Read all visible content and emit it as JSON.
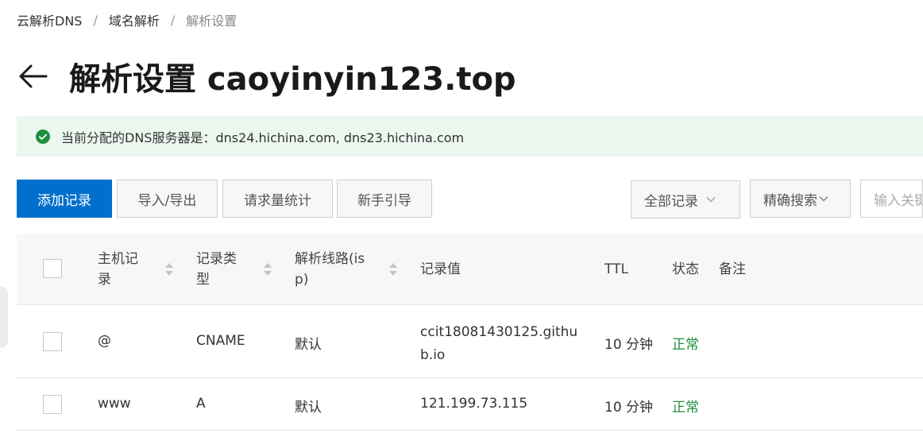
{
  "breadcrumb": {
    "items": [
      "云解析DNS",
      "域名解析",
      "解析设置"
    ],
    "separator": "/"
  },
  "page": {
    "title": "解析设置 caoyinyin123.top"
  },
  "alert": {
    "text": "当前分配的DNS服务器是：dns24.hichina.com, dns23.hichina.com",
    "color": "#1e8e3e"
  },
  "toolbar": {
    "add_label": "添加记录",
    "import_export_label": "导入/导出",
    "stats_label": "请求量统计",
    "guide_label": "新手引导",
    "filter_value": "全部记录",
    "search_mode_value": "精确搜索",
    "search_placeholder": "输入关键字"
  },
  "table": {
    "headers": {
      "host": "主机记录",
      "type": "记录类型",
      "line": "解析线路(isp)",
      "value": "记录值",
      "ttl": "TTL",
      "status": "状态",
      "remark": "备注"
    },
    "rows": [
      {
        "host": "@",
        "type": "CNAME",
        "line": "默认",
        "value": "ccit18081430125.github.io",
        "ttl": "10 分钟",
        "status": "正常"
      },
      {
        "host": "www",
        "type": "A",
        "line": "默认",
        "value": "121.199.73.115",
        "ttl": "10 分钟",
        "status": "正常"
      }
    ]
  },
  "colors": {
    "primary": "#0070cc",
    "success": "#1e8e3e",
    "alert_bg": "#ebf7ef"
  }
}
